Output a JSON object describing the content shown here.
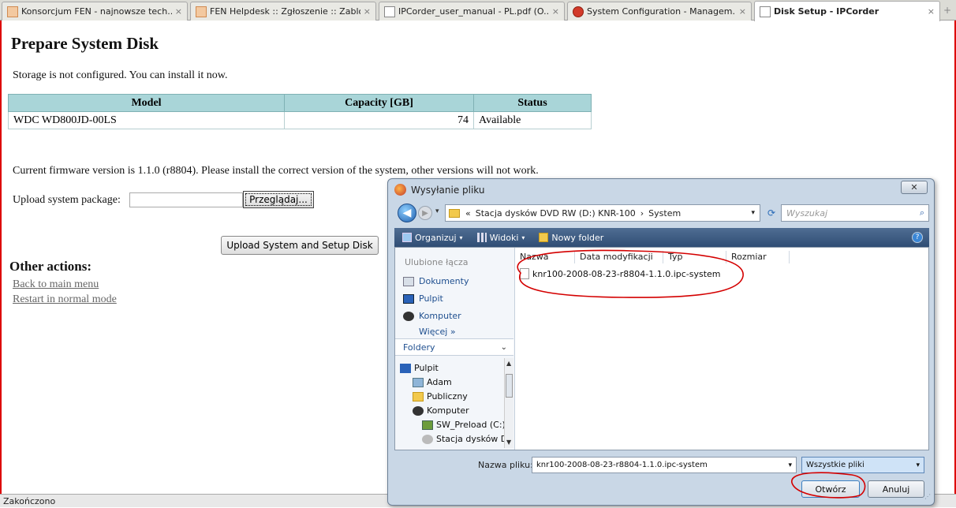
{
  "browser": {
    "tabs": [
      {
        "label": "Konsorcjum FEN - najnowsze tech...",
        "close": "×"
      },
      {
        "label": "FEN Helpdesk :: Zgłoszenie :: Zablo...",
        "close": "×"
      },
      {
        "label": "IPCorder_user_manual - PL.pdf (O...",
        "close": "×"
      },
      {
        "label": "System Configuration - Managem...",
        "close": "×"
      },
      {
        "label": "Disk Setup - IPCorder",
        "close": "×"
      }
    ],
    "new_tab": "+",
    "status": "Zakończono"
  },
  "page": {
    "title": "Prepare System Disk",
    "storage_msg": "Storage is not configured. You can install it now.",
    "table": {
      "headers": [
        "Model",
        "Capacity [GB]",
        "Status"
      ],
      "rows": [
        [
          "WDC WD800JD-00LS",
          "74",
          "Available"
        ]
      ]
    },
    "firmware_msg": "Current firmware version is 1.1.0 (r8804). Please install the correct version of the system, other versions will not work.",
    "upload_label": "Upload system package:",
    "browse_btn": "Przeglądaj...",
    "upload_btn": "Upload System and Setup Disk",
    "other_actions": "Other actions:",
    "links": [
      "Back to main menu",
      "Restart in normal mode"
    ]
  },
  "dialog": {
    "title": "Wysyłanie pliku",
    "close": "✕",
    "nav": {
      "back": "◀",
      "forward": "▶",
      "history": "▾"
    },
    "address": {
      "prefix": "«",
      "crumbs": [
        "Stacja dysków DVD RW (D:) KNR-100",
        "System"
      ],
      "separator": "›",
      "dropdown": "▾",
      "refresh": "⟳"
    },
    "search": {
      "placeholder": "Wyszukaj",
      "icon": "⌕"
    },
    "toolbar": {
      "organize": "Organizuj",
      "views": "Widoki",
      "new_folder": "Nowy folder",
      "arrow": "▾",
      "help": "?"
    },
    "favorites": {
      "header": "Ulubione łącza",
      "items": [
        "Dokumenty",
        "Pulpit",
        "Komputer",
        "Więcej »"
      ]
    },
    "folders": {
      "header": "Foldery",
      "chevron": "⌄",
      "tree": [
        "Pulpit",
        "Adam",
        "Publiczny",
        "Komputer",
        "SW_Preload (C:)",
        "Stacja dysków D\\"
      ],
      "scroll_up": "▲",
      "scroll_down": "▼"
    },
    "columns": [
      "Nazwa",
      "Data modyfikacji",
      "Typ",
      "Rozmiar"
    ],
    "files": [
      "knr100-2008-08-23-r8804-1.1.0.ipc-system"
    ],
    "filename_label": "Nazwa pliku:",
    "filename_value": "knr100-2008-08-23-r8804-1.1.0.ipc-system",
    "filetype": "Wszystkie pliki",
    "open_btn": "Otwórz",
    "cancel_btn": "Anuluj",
    "grip": "⋰"
  },
  "colors": {
    "table_header": "#a9d5d8",
    "annotation": "#d40000",
    "dialog_frame": "#c9d7e6",
    "toolbar": "#3a5a82"
  }
}
